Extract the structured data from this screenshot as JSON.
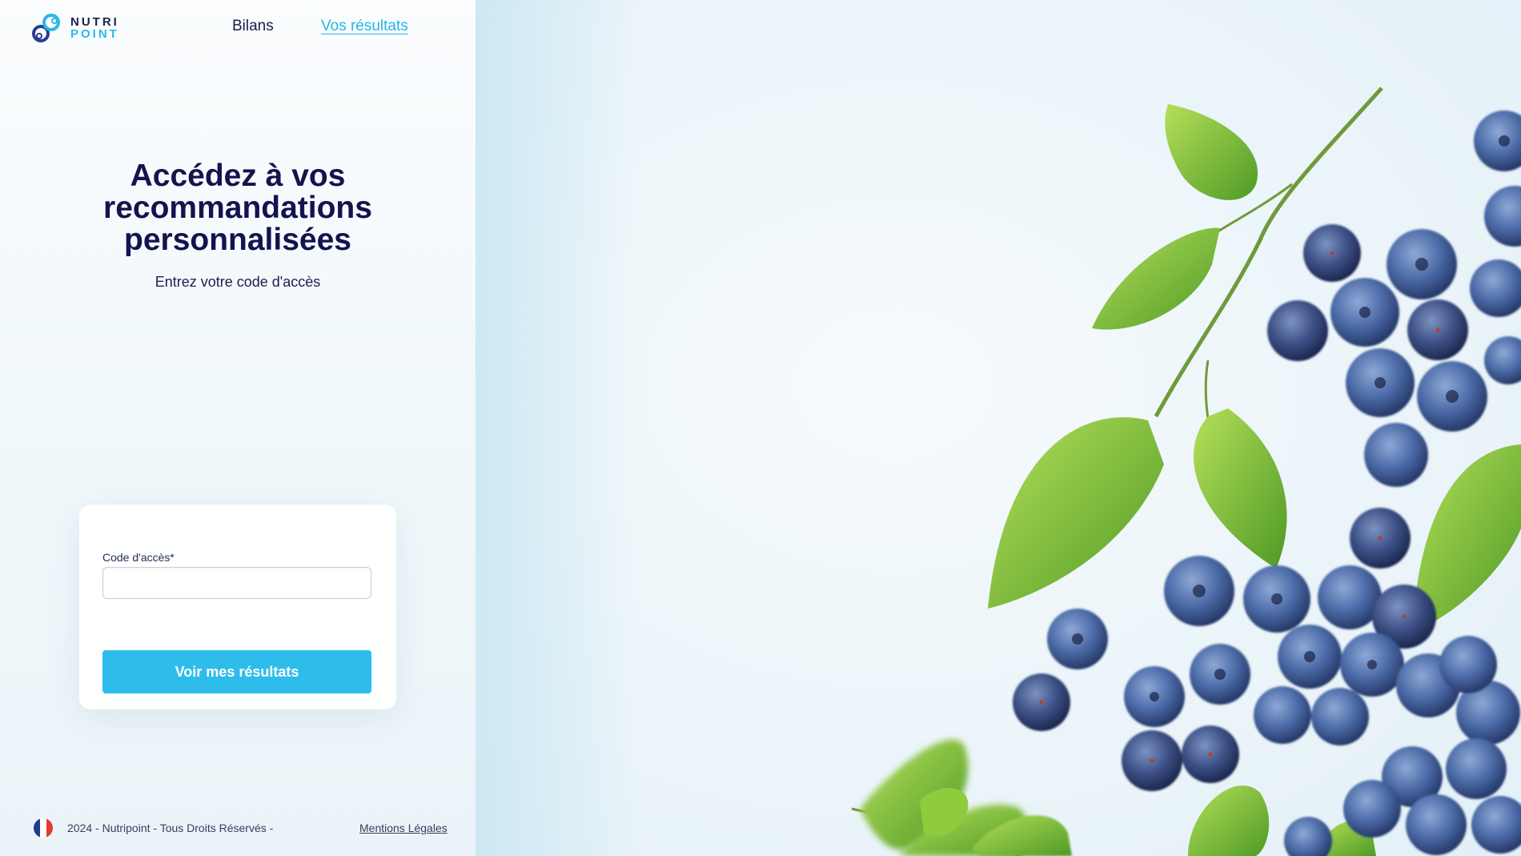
{
  "brand": {
    "line1": "NUTRI",
    "line2": "POINT"
  },
  "nav": {
    "bilans": "Bilans",
    "results": "Vos résultats"
  },
  "hero": {
    "title_line1": "Accédez à vos",
    "title_line2": "recommandations",
    "title_line3": "personnalisées",
    "subtitle": "Entrez votre code d'accès"
  },
  "form": {
    "code_label": "Code d'accès*",
    "code_value": "",
    "submit_label": "Voir mes résultats"
  },
  "footer": {
    "copyright": "2024 - Nutripoint - Tous Droits Réservés -",
    "legal": "Mentions Légales",
    "language": "fr-flag-icon"
  },
  "colors": {
    "accent": "#2ebdeb",
    "title": "#13134f",
    "nav_active": "#27b5e6"
  },
  "hero_image": "blueberries-and-leaves-photo"
}
